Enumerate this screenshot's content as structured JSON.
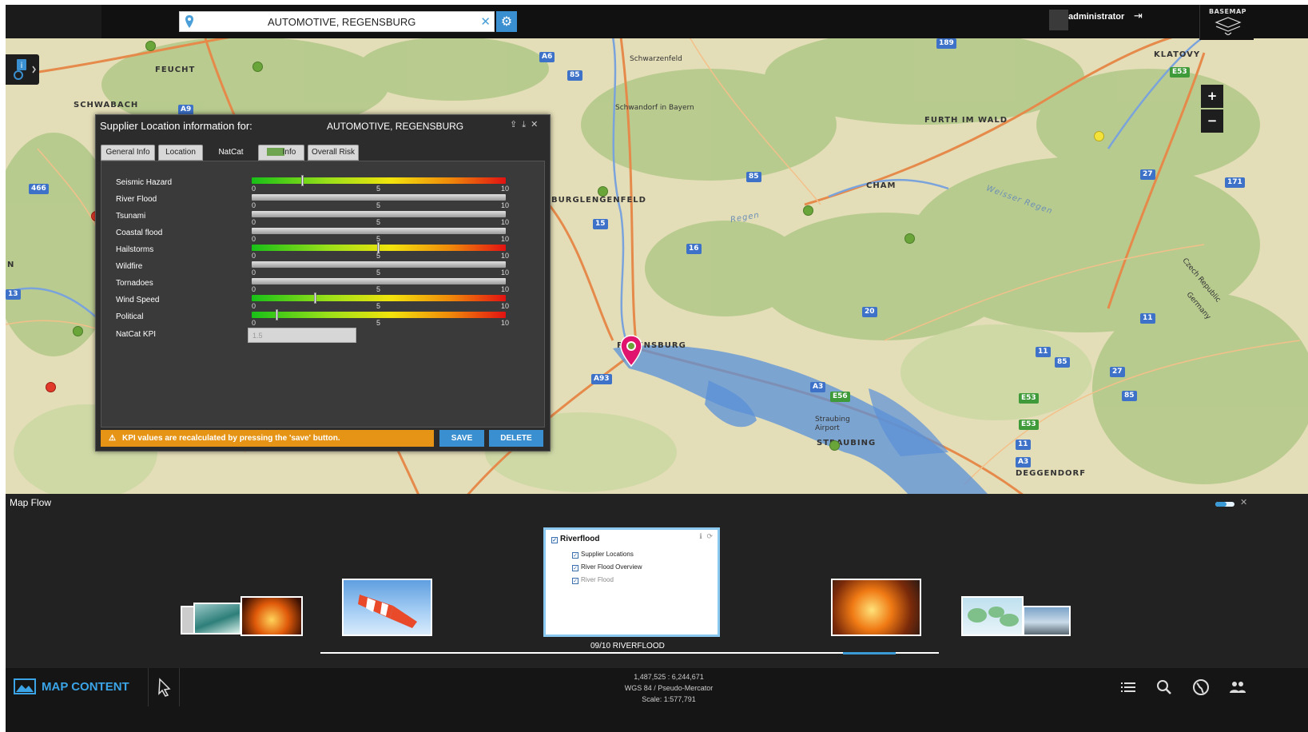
{
  "search": {
    "value": "AUTOMOTIVE, REGENSBURG"
  },
  "user": {
    "name": "administrator"
  },
  "basemap": {
    "label": "BASEMAP"
  },
  "zoom": {
    "in": "+",
    "out": "−"
  },
  "map": {
    "places": [
      "FEUCHT",
      "SCHWABACH",
      "KLATOVY",
      "FURTH IM WALD",
      "CHAM",
      "REGENSBURG",
      "DEGGENDORF",
      "STRAUBING",
      "BURGLENGENFELD",
      "Schwandorf in Bayern",
      "Schwarzenfeld",
      "Czech Republic",
      "Germany",
      "Straubing Airport",
      "Weisser Regen",
      "Regen",
      "N"
    ],
    "shields": [
      "A6",
      "A9",
      "85",
      "189",
      "E53",
      "466",
      "85",
      "15",
      "16",
      "20",
      "27",
      "171",
      "13",
      "11",
      "85",
      "27",
      "85",
      "A93",
      "A3",
      "E56",
      "E53",
      "E53",
      "11",
      "11",
      "A3"
    ]
  },
  "dialog": {
    "title": "Supplier Location information for:",
    "supplier": "AUTOMOTIVE, REGENSBURG",
    "tabs": [
      "General Info",
      "Location",
      "NatCat",
      "Info",
      "Overall Risk"
    ],
    "active_tab": "NatCat",
    "hazards": [
      {
        "label": "Seismic Hazard",
        "value": 2,
        "style": "gradient"
      },
      {
        "label": "River Flood",
        "value": null,
        "style": "grey"
      },
      {
        "label": "Tsunami",
        "value": null,
        "style": "grey"
      },
      {
        "label": "Coastal flood",
        "value": null,
        "style": "grey"
      },
      {
        "label": "Hailstorms",
        "value": 5,
        "style": "gradient"
      },
      {
        "label": "Wildfire",
        "value": null,
        "style": "grey"
      },
      {
        "label": "Tornadoes",
        "value": null,
        "style": "grey"
      },
      {
        "label": "Wind Speed",
        "value": 2.5,
        "style": "gradient"
      },
      {
        "label": "Political",
        "value": 1,
        "style": "gradient"
      }
    ],
    "scale": [
      "0",
      "5",
      "10"
    ],
    "kpi": {
      "label": "NatCat KPI",
      "value": "1.5"
    },
    "warning": "KPI values are recalculated by pressing the 'save' button.",
    "save": "SAVE",
    "delete": "DELETE"
  },
  "mapflow": {
    "title": "Map Flow",
    "active": {
      "title": "Riverflood",
      "items": [
        "Supplier Locations",
        "River Flood Overview",
        "River Flood"
      ]
    },
    "caption": "09/10 RIVERFLOOD"
  },
  "bottom": {
    "map_content": "MAP CONTENT",
    "coords": "1,487,525  :  6,244,671",
    "crs": "WGS 84 / Pseudo-Mercator",
    "scale": "Scale: 1:577,791"
  },
  "colors": {
    "accent": "#3a8fd0",
    "warning": "#e59416",
    "flood": "#5a90d8"
  }
}
